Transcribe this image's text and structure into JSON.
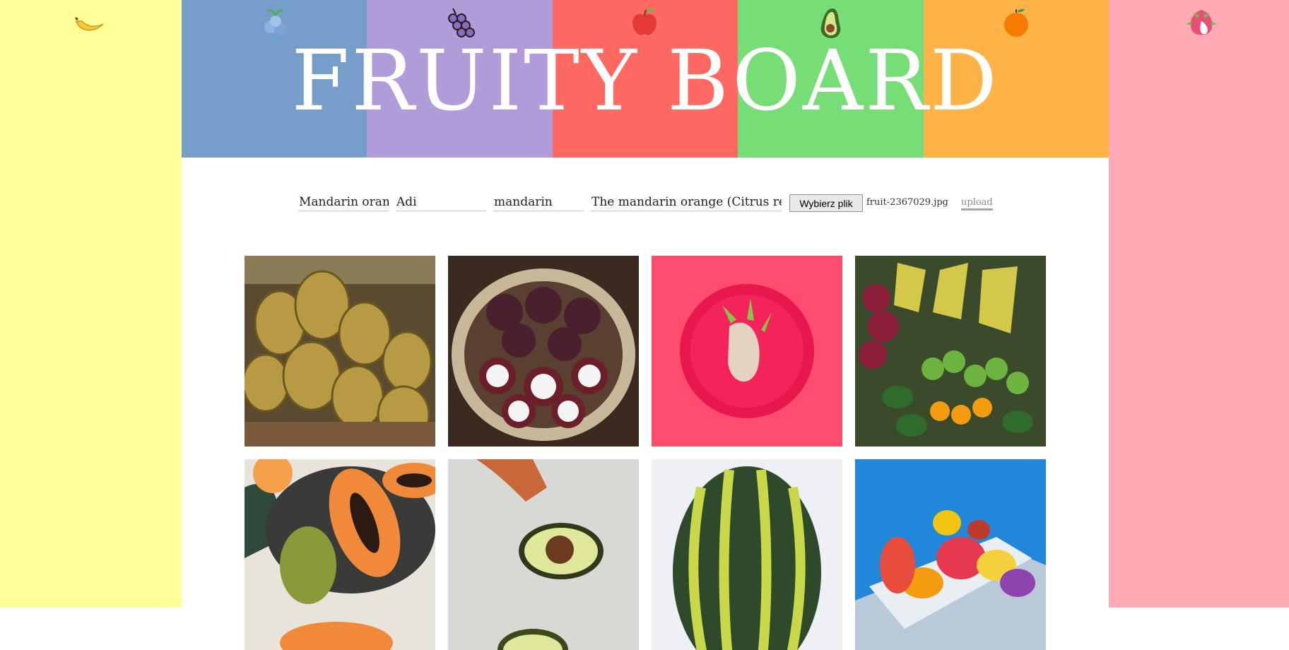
{
  "header": {
    "title": "FRUITY BOARD",
    "stripes": [
      "#ffff99",
      "#779ecb",
      "#b19cd9",
      "#ff6961",
      "#77dd77",
      "#ffb347",
      "#ffaab5"
    ],
    "icons": [
      "banana-icon",
      "blueberry-icon",
      "grapes-icon",
      "apple-icon",
      "avocado-icon",
      "orange-icon",
      "dragon-fruit-icon"
    ]
  },
  "form": {
    "name_value": "Mandarin oran",
    "author_value": "Adi",
    "tag_value": "mandarin",
    "description_value": "The mandarin orange (Citrus re",
    "file_button_label": "Wybierz plik",
    "file_name": "fruit-2367029.jpg",
    "upload_label": "upload"
  },
  "gallery": {
    "tiles": [
      "durian",
      "mangosteen",
      "dragon-fruit-plate",
      "fruit-market",
      "papaya",
      "avocado",
      "watermelon",
      "fruit-platter"
    ]
  }
}
